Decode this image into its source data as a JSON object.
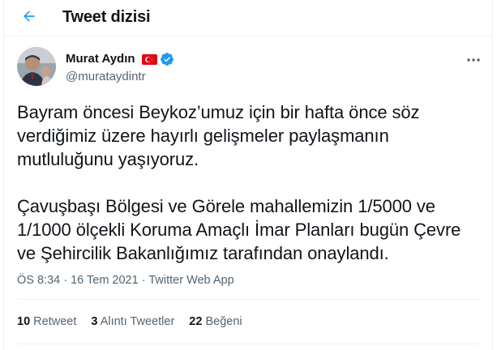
{
  "header": {
    "title": "Tweet dizisi",
    "back_icon": "arrow-left-icon"
  },
  "author": {
    "name": "Murat Aydın",
    "handle": "@murataydintr",
    "flag_icon": "turkey-flag-icon",
    "verified_icon": "verified-badge-icon"
  },
  "tweet": {
    "paragraphs": [
      "Bayram öncesi Beykoz’umuz için bir hafta önce söz verdiğimiz üzere hayırlı gelişmeler paylaşmanın mutluluğunu yaşıyoruz.",
      "Çavuşbaşı Bölgesi ve Görele mahallemizin 1/5000 ve 1/1000 ölçekli Koruma Amaçlı İmar Planları bugün Çevre ve Şehircilik Bakanlığımız tarafından onaylandı."
    ],
    "time": "ÖS 8:34",
    "date": "16 Tem 2021",
    "separator": "·",
    "source": "Twitter Web App"
  },
  "stats": {
    "retweets_count": "10",
    "retweets_label": "Retweet",
    "quotes_count": "3",
    "quotes_label": "Alıntı Tweetler",
    "likes_count": "22",
    "likes_label": "Beğeni"
  },
  "colors": {
    "accent": "#1d9bf0",
    "text": "#0f1419",
    "secondary": "#536471",
    "border": "#eff3f4"
  }
}
